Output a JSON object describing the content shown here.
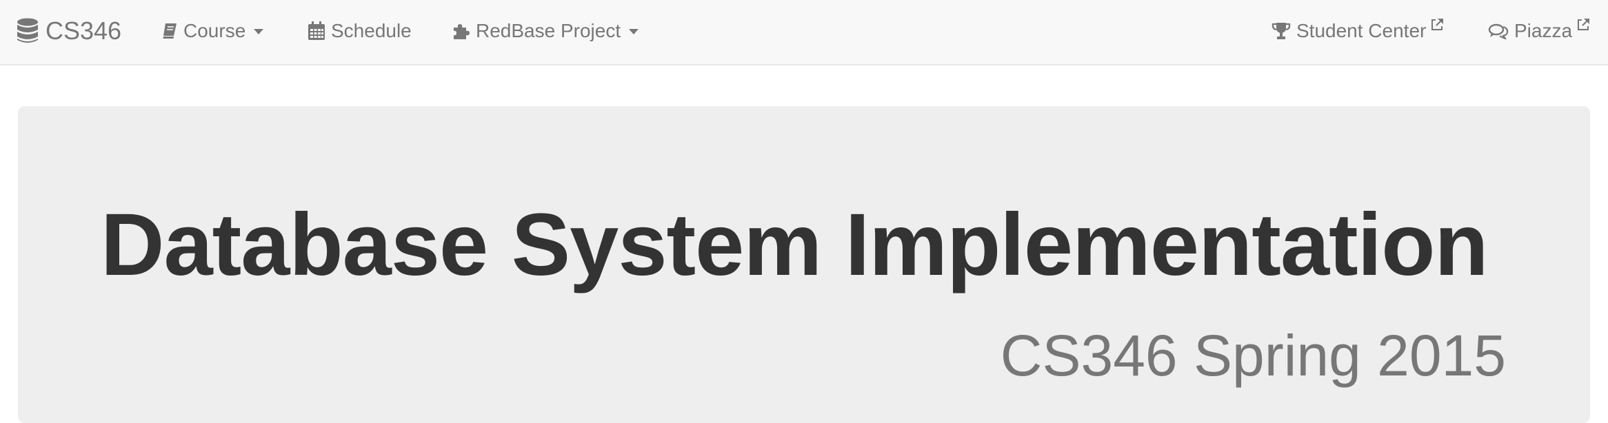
{
  "navbar": {
    "brand": {
      "label": "CS346",
      "icon": "database-icon"
    },
    "left_items": [
      {
        "label": "Course",
        "icon": "book-icon",
        "dropdown": true
      },
      {
        "label": "Schedule",
        "icon": "calendar-icon",
        "dropdown": false
      },
      {
        "label": "RedBase Project",
        "icon": "puzzle-icon",
        "dropdown": true
      }
    ],
    "right_items": [
      {
        "label": "Student Center",
        "icon": "trophy-icon",
        "external": true
      },
      {
        "label": "Piazza",
        "icon": "comments-icon",
        "external": true
      }
    ]
  },
  "jumbotron": {
    "title": "Database System Implementation",
    "subtitle": "CS346 Spring 2015"
  },
  "colors": {
    "navbar_bg": "#f8f8f8",
    "nav_text": "#777777",
    "jumbotron_bg": "#eeeeee",
    "title_text": "#333333",
    "subtitle_text": "#777777"
  }
}
